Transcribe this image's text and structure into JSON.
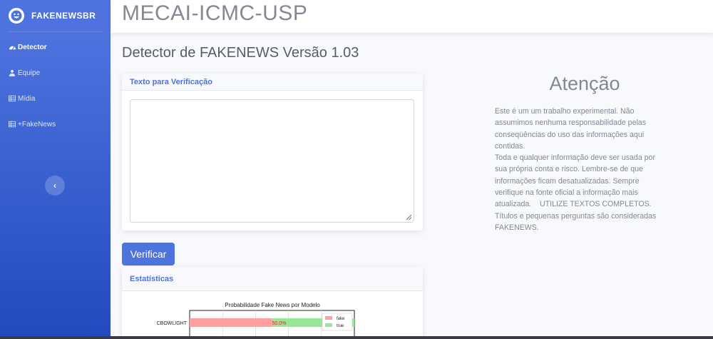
{
  "sidebar": {
    "brand": "FAKENEWSBR",
    "items": [
      {
        "label": "Detector",
        "icon": "dashboard-icon"
      },
      {
        "label": "Equipe",
        "icon": "user-icon"
      },
      {
        "label": "Mídia",
        "icon": "table-icon"
      },
      {
        "label": "+FakeNews",
        "icon": "table-icon"
      }
    ],
    "toggle_glyph": "‹"
  },
  "topbar": {
    "title": "MECAI-ICMC-USP"
  },
  "page": {
    "heading": "Detector de FAKENEWS Versão 1.03"
  },
  "text_card": {
    "header": "Texto para Verificação",
    "textarea_value": ""
  },
  "verify_button": "Verificar",
  "stats_card": {
    "header": "Estatísticas"
  },
  "attention": {
    "title": "Atenção",
    "lines": [
      "Este é um um trabalho experimental. Não",
      "assumimos nenhuma responsabilidade pelas",
      "conseqüências do uso das informações aqui",
      "contidas.",
      "Toda e qualquer informação deve ser usada por",
      "sua própria conta e risco. Lembre-se de que",
      "informações ficam desatualizadas. Sempre",
      "verifique na fonte oficial a informação mais",
      "atualizada.    UTILIZE TEXTOS COMPLETOS.",
      "Títulos e pequenas perguntas são consideradas",
      "FAKENEWS."
    ]
  },
  "chart_data": {
    "type": "bar",
    "title": "Probabilidade Fake News por Modelo",
    "categories": [
      "CBOWLIGHT"
    ],
    "series": [
      {
        "name": "fake",
        "values": [
          50.0
        ],
        "color": "#ff9f9f"
      },
      {
        "name": "true",
        "values": [
          50.0
        ],
        "color": "#98e698"
      }
    ],
    "data_labels": [
      "50.0%"
    ],
    "label_color": "#d62728",
    "xlim": [
      0,
      100
    ],
    "stacked": true,
    "orientation": "horizontal",
    "legend": "top-right"
  },
  "colors": {
    "primary": "#4e73df",
    "text_muted": "#858796"
  }
}
